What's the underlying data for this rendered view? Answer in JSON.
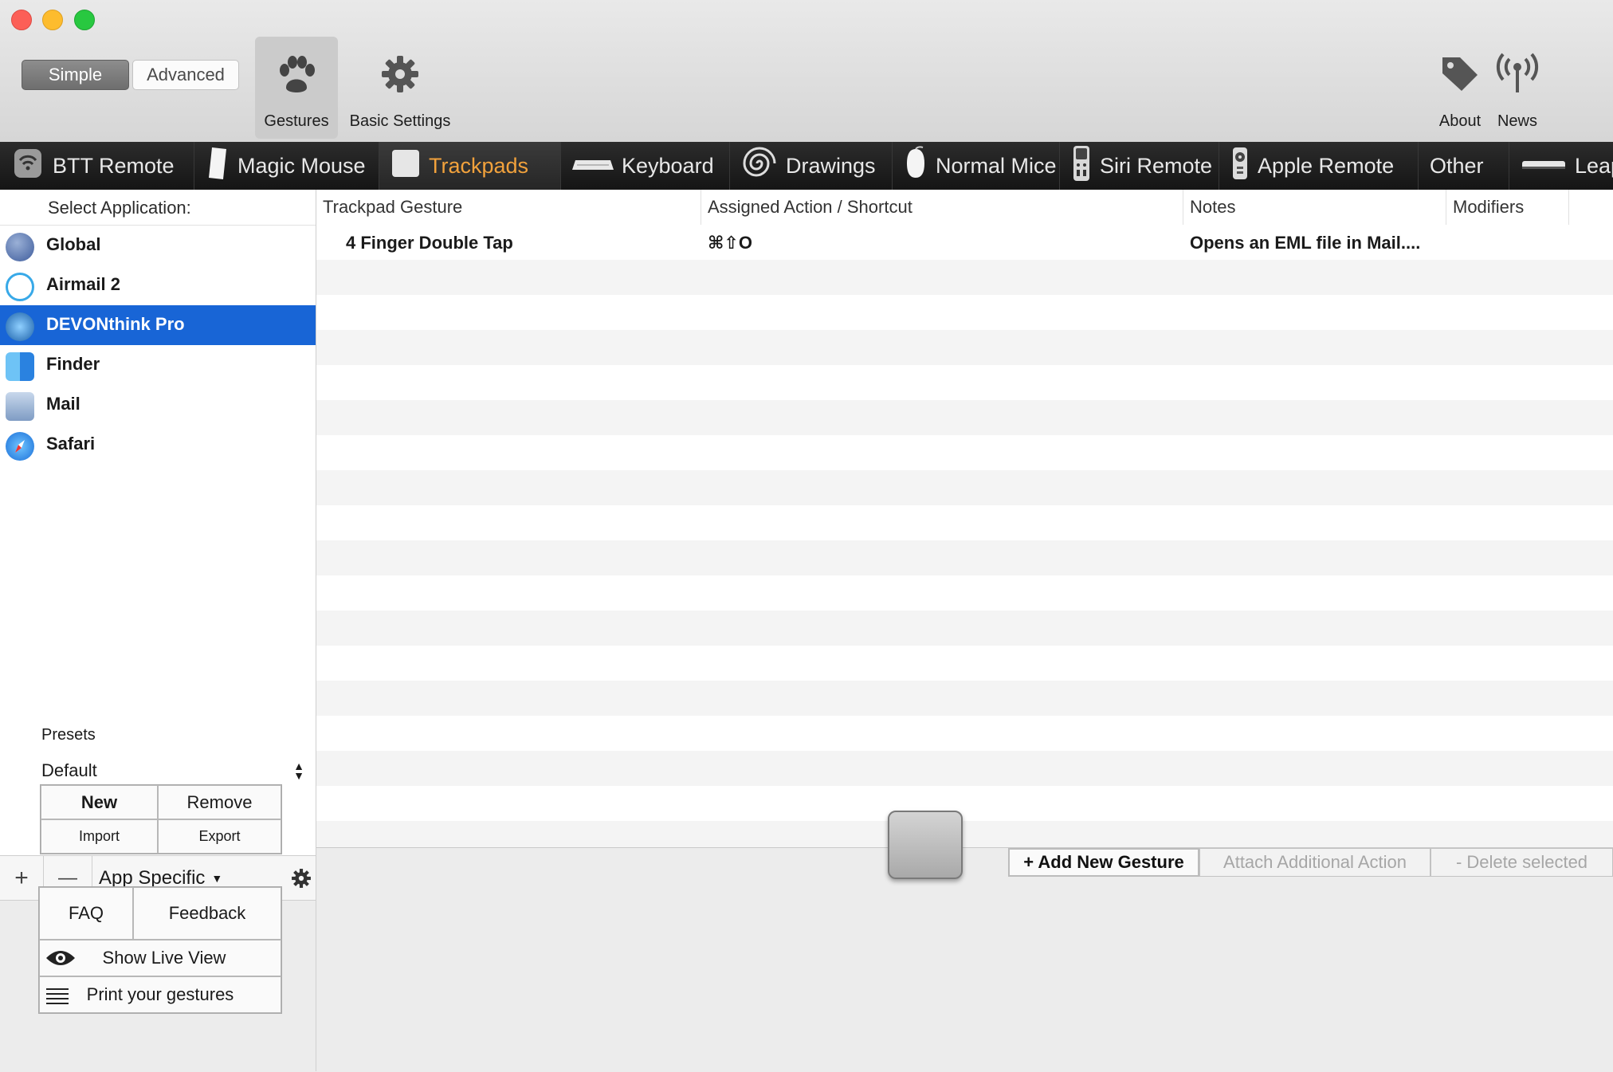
{
  "window": {
    "controls": {
      "close_color": "#fc5f57",
      "minimize_color": "#fdbc2e",
      "zoom_color": "#28c840"
    }
  },
  "toolbar": {
    "mode_simple": "Simple",
    "mode_advanced": "Advanced",
    "gestures_label": "Gestures",
    "basic_settings_label": "Basic Settings",
    "about_label": "About",
    "news_label": "News"
  },
  "device_tabs": [
    {
      "label": "BTT Remote",
      "icon": "remote-wifi-icon"
    },
    {
      "label": "Magic Mouse",
      "icon": "magic-mouse-icon"
    },
    {
      "label": "Trackpads",
      "icon": "trackpad-icon",
      "active": true
    },
    {
      "label": "Keyboard",
      "icon": "keyboard-icon"
    },
    {
      "label": "Drawings",
      "icon": "spiral-icon"
    },
    {
      "label": "Normal Mice",
      "icon": "mouse-icon"
    },
    {
      "label": "Siri Remote",
      "icon": "siri-remote-icon"
    },
    {
      "label": "Apple Remote",
      "icon": "apple-remote-icon"
    },
    {
      "label": "Other",
      "icon": ""
    },
    {
      "label": "Leap",
      "icon": "leap-icon"
    }
  ],
  "sidebar": {
    "header": "Select Application:",
    "apps": [
      {
        "name": "Global",
        "icon": "globe-icon"
      },
      {
        "name": "Airmail 2",
        "icon": "airmail-icon"
      },
      {
        "name": "DEVONthink Pro",
        "icon": "devonthink-icon",
        "selected": true
      },
      {
        "name": "Finder",
        "icon": "finder-icon"
      },
      {
        "name": "Mail",
        "icon": "mail-icon"
      },
      {
        "name": "Safari",
        "icon": "safari-icon"
      }
    ],
    "add_symbol": "+",
    "remove_symbol": "—",
    "scope_label": "App Specific",
    "presets_label": "Presets",
    "preset_value": "Default",
    "buttons": {
      "new": "New",
      "remove": "Remove",
      "import": "Import",
      "export": "Export"
    },
    "help": {
      "faq": "FAQ",
      "feedback": "Feedback",
      "live_view": "Show Live View",
      "print": "Print your gestures"
    }
  },
  "table": {
    "columns": [
      "Trackpad Gesture",
      "Assigned Action / Shortcut",
      "Notes",
      "Modifiers"
    ],
    "rows": [
      {
        "gesture": "4 Finger Double Tap",
        "action": "⌘⇧O",
        "notes": "Opens an EML file in Mail....",
        "modifiers": ""
      }
    ]
  },
  "actions": {
    "add": "+ Add New Gesture",
    "attach": "Attach Additional Action",
    "delete": "- Delete selected"
  },
  "colors": {
    "selection": "#1865d6",
    "active_tab": "#f2a23c"
  }
}
